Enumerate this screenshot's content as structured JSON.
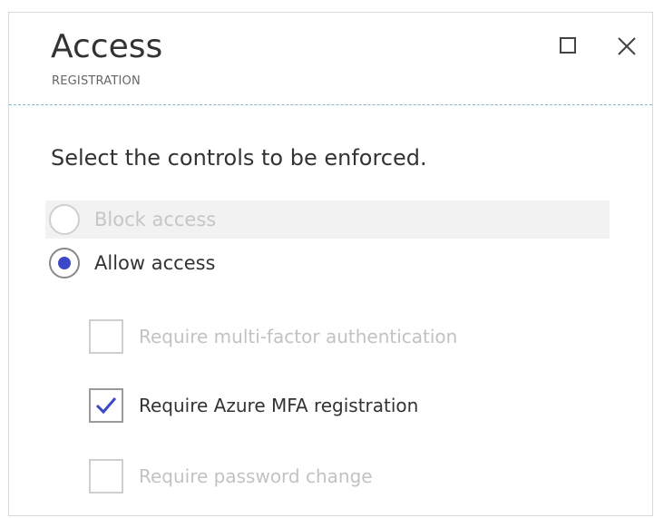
{
  "window": {
    "title": "Access",
    "subtitle": "REGISTRATION",
    "maximize_icon": "maximize-icon",
    "close_icon": "close-icon"
  },
  "instruction": "Select the controls to be enforced.",
  "access_options": [
    {
      "label": "Block access",
      "selected": false,
      "enabled": false
    },
    {
      "label": "Allow access",
      "selected": true,
      "enabled": true
    }
  ],
  "controls": [
    {
      "label": "Require multi-factor authentication",
      "checked": false,
      "enabled": false
    },
    {
      "label": "Require Azure MFA registration",
      "checked": true,
      "enabled": true
    },
    {
      "label": "Require password change",
      "checked": false,
      "enabled": false
    }
  ],
  "colors": {
    "accent": "#3b48c7",
    "divider": "#7fb6d8",
    "disabled_text": "#c6c6c6"
  }
}
